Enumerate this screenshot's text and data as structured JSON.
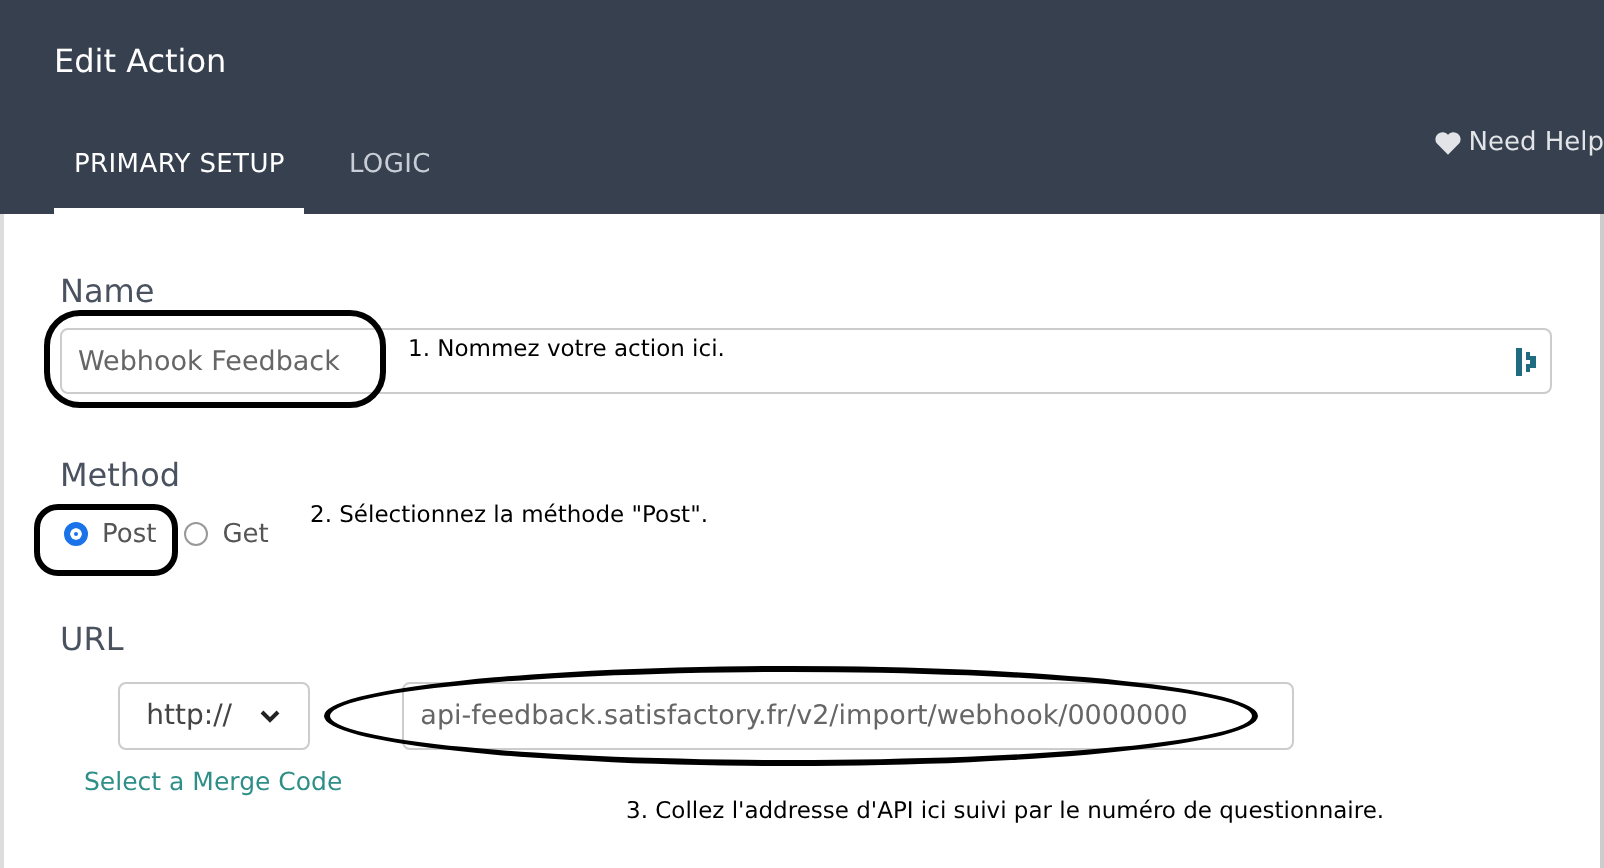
{
  "window": {
    "title": "Edit Action"
  },
  "tabs": [
    {
      "label": "PRIMARY SETUP",
      "selected": true
    },
    {
      "label": "LOGIC",
      "selected": false
    }
  ],
  "help_link": "Need Help",
  "name_field": {
    "label": "Name",
    "value": "Webhook Feedback"
  },
  "method": {
    "label": "Method",
    "options": [
      {
        "label": "Post",
        "selected": true
      },
      {
        "label": "Get",
        "selected": false
      }
    ]
  },
  "url": {
    "label": "URL",
    "protocol": "http://",
    "value": "api-feedback.satisfactory.fr/v2/import/webhook/0000000",
    "merge_code_link": "Select a Merge Code"
  },
  "annotations": [
    "1. Nommez votre action ici.",
    "2. Sélectionnez la méthode \"Post\".",
    "3. Collez l'addresse d'API ici suivi par le numéro de questionnaire."
  ]
}
